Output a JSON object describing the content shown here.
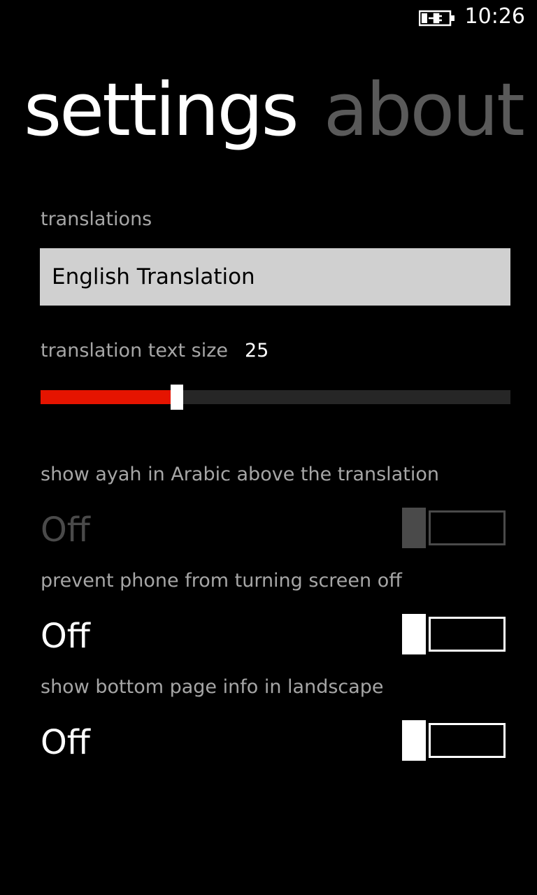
{
  "status_bar": {
    "time": "10:26",
    "battery_icon": "battery-charging-icon"
  },
  "pivot": {
    "tabs": [
      {
        "label": "settings",
        "active": true
      },
      {
        "label": "about",
        "active": false
      }
    ]
  },
  "settings": {
    "translations_label": "translations",
    "translation_selected": "English Translation",
    "text_size_label": "translation text size",
    "text_size_value": "25",
    "text_size_fraction": 0.29,
    "slider_fill_color": "#e51400",
    "arabic_label": "show ayah in Arabic above the translation",
    "arabic_state": "Off",
    "arabic_enabled": false,
    "screen_off_label": "prevent phone from turning screen off",
    "screen_off_state": "Off",
    "landscape_label": "show bottom page info in landscape",
    "landscape_state": "Off"
  }
}
